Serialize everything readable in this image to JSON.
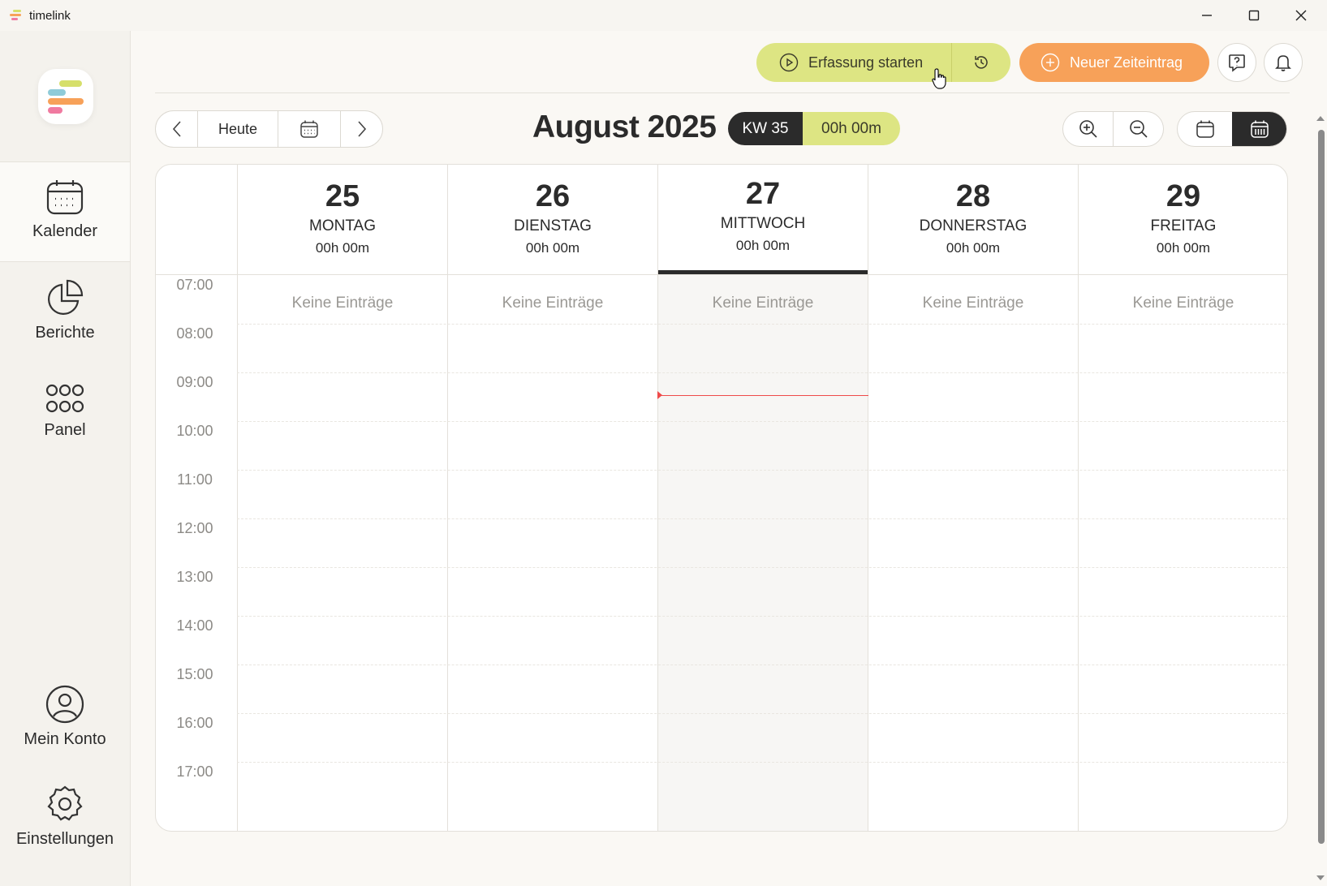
{
  "window": {
    "title": "timelink"
  },
  "sidebar": {
    "items": [
      {
        "label": "Kalender",
        "icon": "calendar-icon",
        "active": true
      },
      {
        "label": "Berichte",
        "icon": "pie-chart-icon"
      },
      {
        "label": "Panel",
        "icon": "grid-icon"
      },
      {
        "label": "Mein Konto",
        "icon": "user-icon"
      },
      {
        "label": "Einstellungen",
        "icon": "gear-icon"
      }
    ]
  },
  "toolbar": {
    "start_label": "Erfassung starten",
    "new_entry_label": "Neuer Zeiteintrag"
  },
  "calendar_nav": {
    "today_label": "Heute",
    "month_title": "August 2025",
    "week_label": "KW 35",
    "week_total": "00h 00m"
  },
  "days": [
    {
      "num": "25",
      "name": "MONTAG",
      "total": "00h 00m",
      "empty": "Keine Einträge"
    },
    {
      "num": "26",
      "name": "DIENSTAG",
      "total": "00h 00m",
      "empty": "Keine Einträge"
    },
    {
      "num": "27",
      "name": "MITTWOCH",
      "total": "00h 00m",
      "empty": "Keine Einträge",
      "today": true
    },
    {
      "num": "28",
      "name": "DONNERSTAG",
      "total": "00h 00m",
      "empty": "Keine Einträge"
    },
    {
      "num": "29",
      "name": "FREITAG",
      "total": "00h 00m",
      "empty": "Keine Einträge"
    }
  ],
  "hours": [
    "07:00",
    "08:00",
    "09:00",
    "10:00",
    "11:00",
    "12:00",
    "13:00",
    "14:00",
    "15:00",
    "16:00",
    "17:00"
  ],
  "colors": {
    "accent_green": "#dde583",
    "accent_orange": "#f7a159",
    "dark": "#2b2b2b",
    "now_line": "#ef4a4a"
  }
}
